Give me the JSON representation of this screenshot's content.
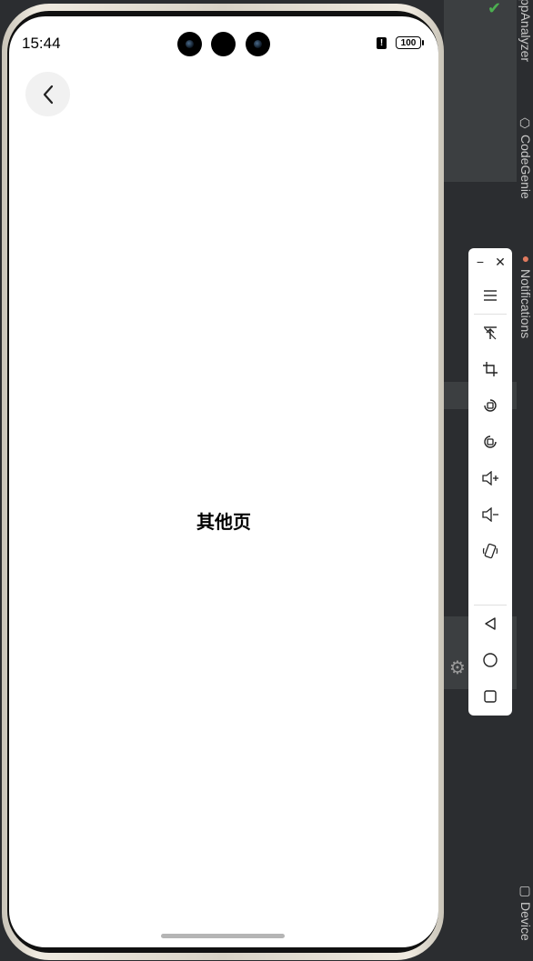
{
  "status_bar": {
    "time": "15:44",
    "alert_glyph": "!",
    "battery_level": "100"
  },
  "page": {
    "title": "其他页"
  },
  "ide_sidebar": {
    "tabs": [
      "ppAnalyzer",
      "CodeGenie",
      "Notifications",
      "Device"
    ]
  },
  "emulator_toolbar": {
    "minimize_label": "−",
    "close_label": "✕",
    "buttons": [
      "menu-icon",
      "pin-icon",
      "crop-icon",
      "rotate-left-icon",
      "rotate-right-icon",
      "volume-up-icon",
      "volume-down-icon",
      "shake-icon",
      "back-nav-icon",
      "home-nav-icon",
      "recents-nav-icon"
    ]
  },
  "colors": {
    "ide_background": "#2b2d30",
    "screen_background": "#ffffff",
    "back_button_background": "#f1f1f1",
    "status_check": "#4caf50"
  }
}
